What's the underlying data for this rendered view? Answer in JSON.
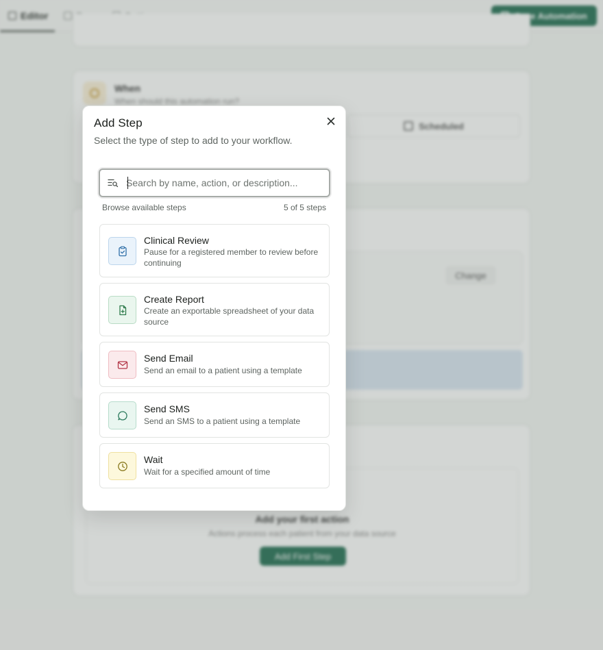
{
  "app": {
    "tabs": [
      {
        "label": "Editor"
      },
      {
        "label": "Runs"
      },
      {
        "label": "Settings"
      }
    ],
    "save_label": "Save Automation",
    "when": {
      "title": "When",
      "subtitle": "When should this automation run?",
      "scheduled_label": "Scheduled"
    },
    "source": {
      "change_label": "Change"
    },
    "first_action": {
      "title": "Add your first action",
      "subtitle": "Actions process each patient from your data source",
      "button_label": "Add First Step"
    }
  },
  "modal": {
    "title": "Add Step",
    "subtitle": "Select the type of step to add to your workflow.",
    "search": {
      "placeholder": "Search by name, action, or description...",
      "value": ""
    },
    "browse_label": "Browse available steps",
    "count_label": "5 of 5 steps",
    "steps": [
      {
        "title": "Clinical Review",
        "description": "Pause for a registered member to review before continuing",
        "icon": "clipboard-check-icon",
        "color": "#2f6fa8"
      },
      {
        "title": "Create Report",
        "description": "Create an exportable spreadsheet of your data source",
        "icon": "file-plus-icon",
        "color": "#2e7a4b"
      },
      {
        "title": "Send Email",
        "description": "Send an email to a patient using a template",
        "icon": "mail-icon",
        "color": "#b23546"
      },
      {
        "title": "Send SMS",
        "description": "Send an SMS to a patient using a template",
        "icon": "message-circle-icon",
        "color": "#2b7a5c"
      },
      {
        "title": "Wait",
        "description": "Wait for a specified amount of time",
        "icon": "clock-icon",
        "color": "#8a7a1f"
      }
    ]
  }
}
